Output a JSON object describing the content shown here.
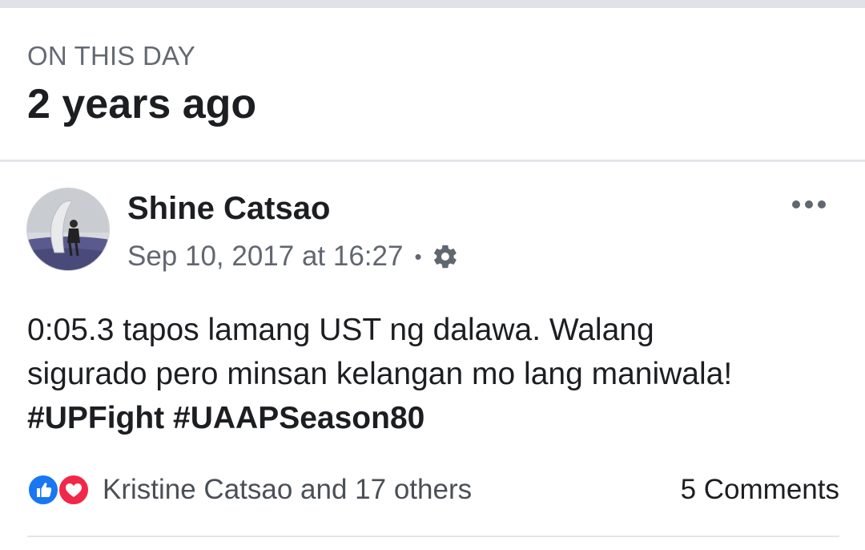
{
  "memory": {
    "kicker": "ON THIS DAY",
    "title": "2 years ago"
  },
  "post": {
    "author": "Shine Catsao",
    "timestamp": "Sep 10, 2017 at 16:27",
    "separator": "•",
    "privacy_icon": "gear-icon",
    "more_icon": "more-options-icon",
    "text_line1": "0:05.3 tapos lamang UST ng dalawa. Walang",
    "text_line2": "sigurado pero minsan kelangan mo lang maniwala!",
    "hashtags": [
      "#UPFight",
      "#UAAPSeason80"
    ]
  },
  "engagement": {
    "reaction_icons": [
      "like-icon",
      "love-icon"
    ],
    "reactions_label": "Kristine Catsao and 17 others",
    "comments_label": "5 Comments"
  },
  "colors": {
    "like": "#1877f2",
    "love": "#f0284a",
    "text_primary": "#1c1e21",
    "text_secondary": "#616770"
  }
}
